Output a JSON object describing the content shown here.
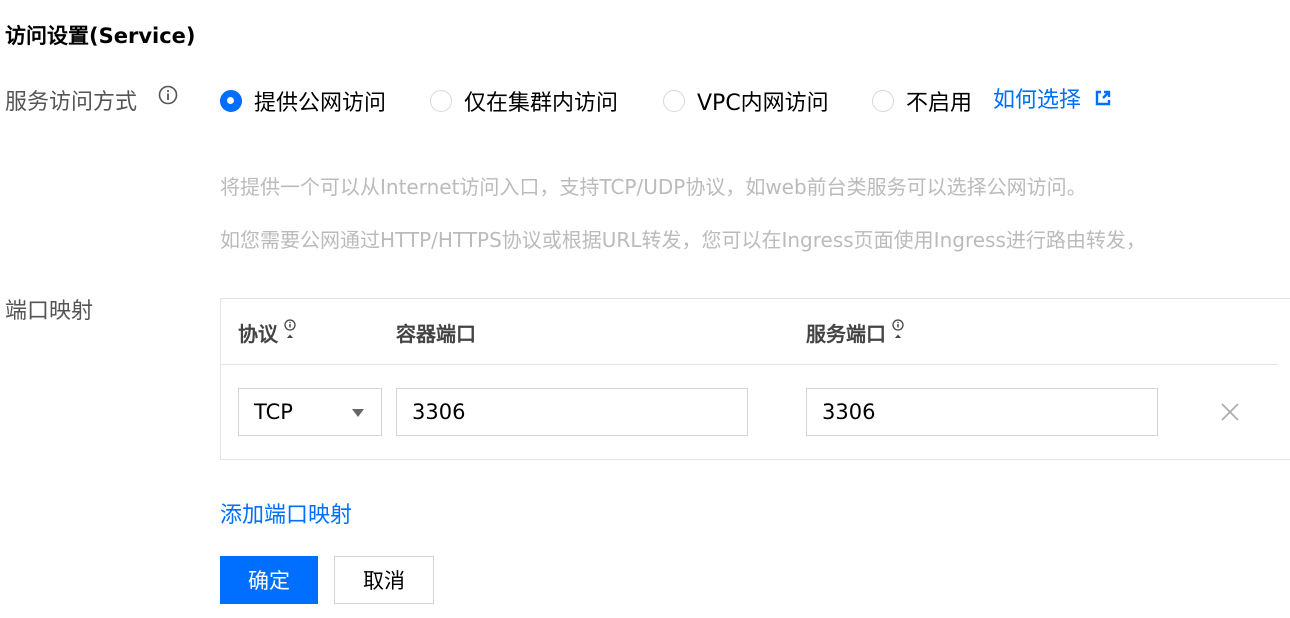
{
  "section_title": "访问设置(Service)",
  "service_access": {
    "label": "服务访问方式",
    "info_icon": "info-circle-icon",
    "options": [
      {
        "label": "提供公网访问",
        "checked": true
      },
      {
        "label": "仅在集群内访问",
        "checked": false
      },
      {
        "label": "VPC内网访问",
        "checked": false
      },
      {
        "label": "不启用",
        "checked": false
      }
    ],
    "help_link": "如何选择",
    "help_link_icon": "external-link-icon",
    "description_lines": [
      "将提供一个可以从Internet访问入口，支持TCP/UDP协议，如web前台类服务可以选择公网访问。",
      "如您需要公网通过HTTP/HTTPS协议或根据URL转发，您可以在Ingress页面使用Ingress进行路由转发，"
    ]
  },
  "port_mapping": {
    "label": "端口映射",
    "columns": [
      "协议",
      "容器端口",
      "服务端口"
    ],
    "rows": [
      {
        "protocol": "TCP",
        "container_port": "3306",
        "service_port": "3306"
      }
    ],
    "add_link": "添加端口映射"
  },
  "actions": {
    "confirm": "确定",
    "cancel": "取消"
  },
  "colors": {
    "accent": "#006eff",
    "muted_text": "#bbbbbb",
    "label_text": "#555555"
  }
}
